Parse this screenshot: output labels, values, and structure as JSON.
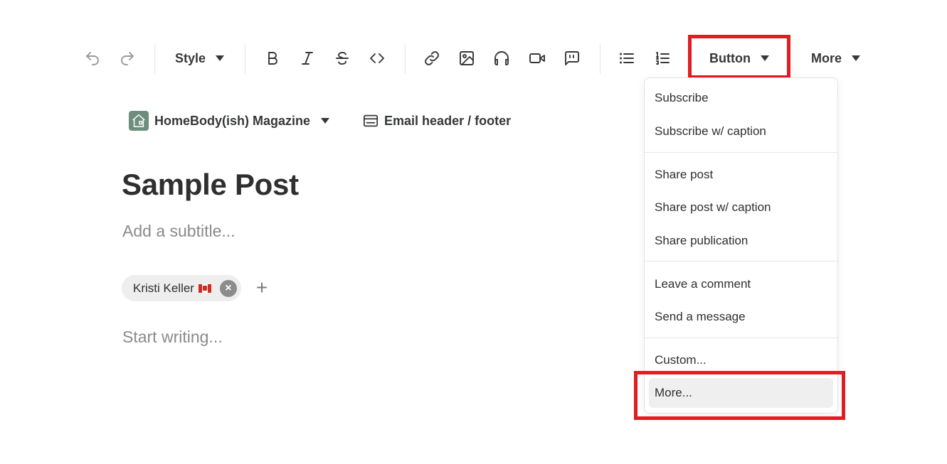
{
  "toolbar": {
    "style_label": "Style",
    "button_label": "Button",
    "more_label": "More",
    "icons": [
      "undo-icon",
      "redo-icon",
      "bold-icon",
      "italic-icon",
      "strikethrough-icon",
      "code-icon",
      "link-icon",
      "image-icon",
      "audio-icon",
      "video-icon",
      "quote-icon",
      "bullet-list-icon",
      "numbered-list-icon"
    ]
  },
  "meta": {
    "publication_name": "HomeBody(ish) Magazine",
    "email_header_label": "Email header / footer"
  },
  "post": {
    "title": "Sample Post",
    "subtitle_placeholder": "Add a subtitle...",
    "author_name": "Kristi Keller",
    "body_placeholder": "Start writing..."
  },
  "menu": {
    "items": [
      {
        "label": "Subscribe"
      },
      {
        "label": "Subscribe w/ caption"
      },
      {
        "label": "Share post"
      },
      {
        "label": "Share post w/ caption"
      },
      {
        "label": "Share publication"
      },
      {
        "label": "Leave a comment"
      },
      {
        "label": "Send a message"
      },
      {
        "label": "Custom..."
      },
      {
        "label": "More..."
      }
    ]
  },
  "colors": {
    "highlight": "#e31b23",
    "text": "#363737",
    "placeholder": "#8a8a8a",
    "logo_bg": "#6e8d7f"
  }
}
